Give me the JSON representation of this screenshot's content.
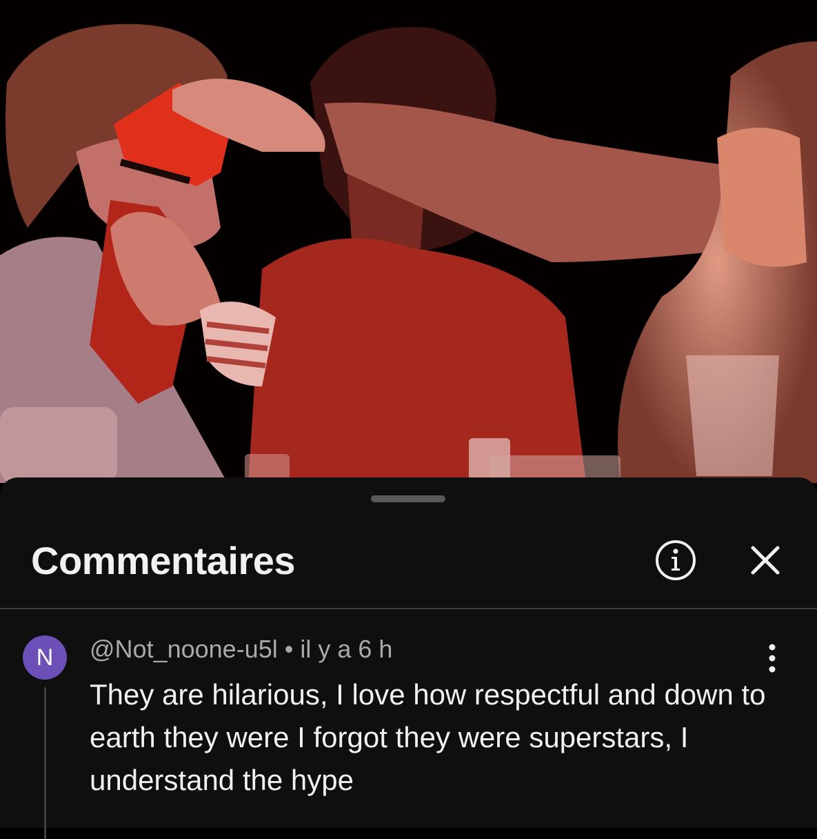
{
  "video": {
    "scene": "three-people-at-table-red-tint"
  },
  "sheet": {
    "title": "Commentaires",
    "info_icon": "info-circle-icon",
    "close_icon": "close-x-icon"
  },
  "comment": {
    "avatar_letter": "N",
    "avatar_color": "#6d4fb8",
    "author": "@Not_noone-u5l",
    "separator": "•",
    "time": "il y a 6 h",
    "text": "They are hilarious, I love how respectful and down to earth they were I forgot they were superstars, I understand the hype",
    "more_icon": "vertical-dots-icon"
  },
  "colors": {
    "sheet_bg": "#0f0f0f",
    "text_primary": "#f1f1f1",
    "text_secondary": "#aaaaaa",
    "divider": "#3d3d3d"
  }
}
